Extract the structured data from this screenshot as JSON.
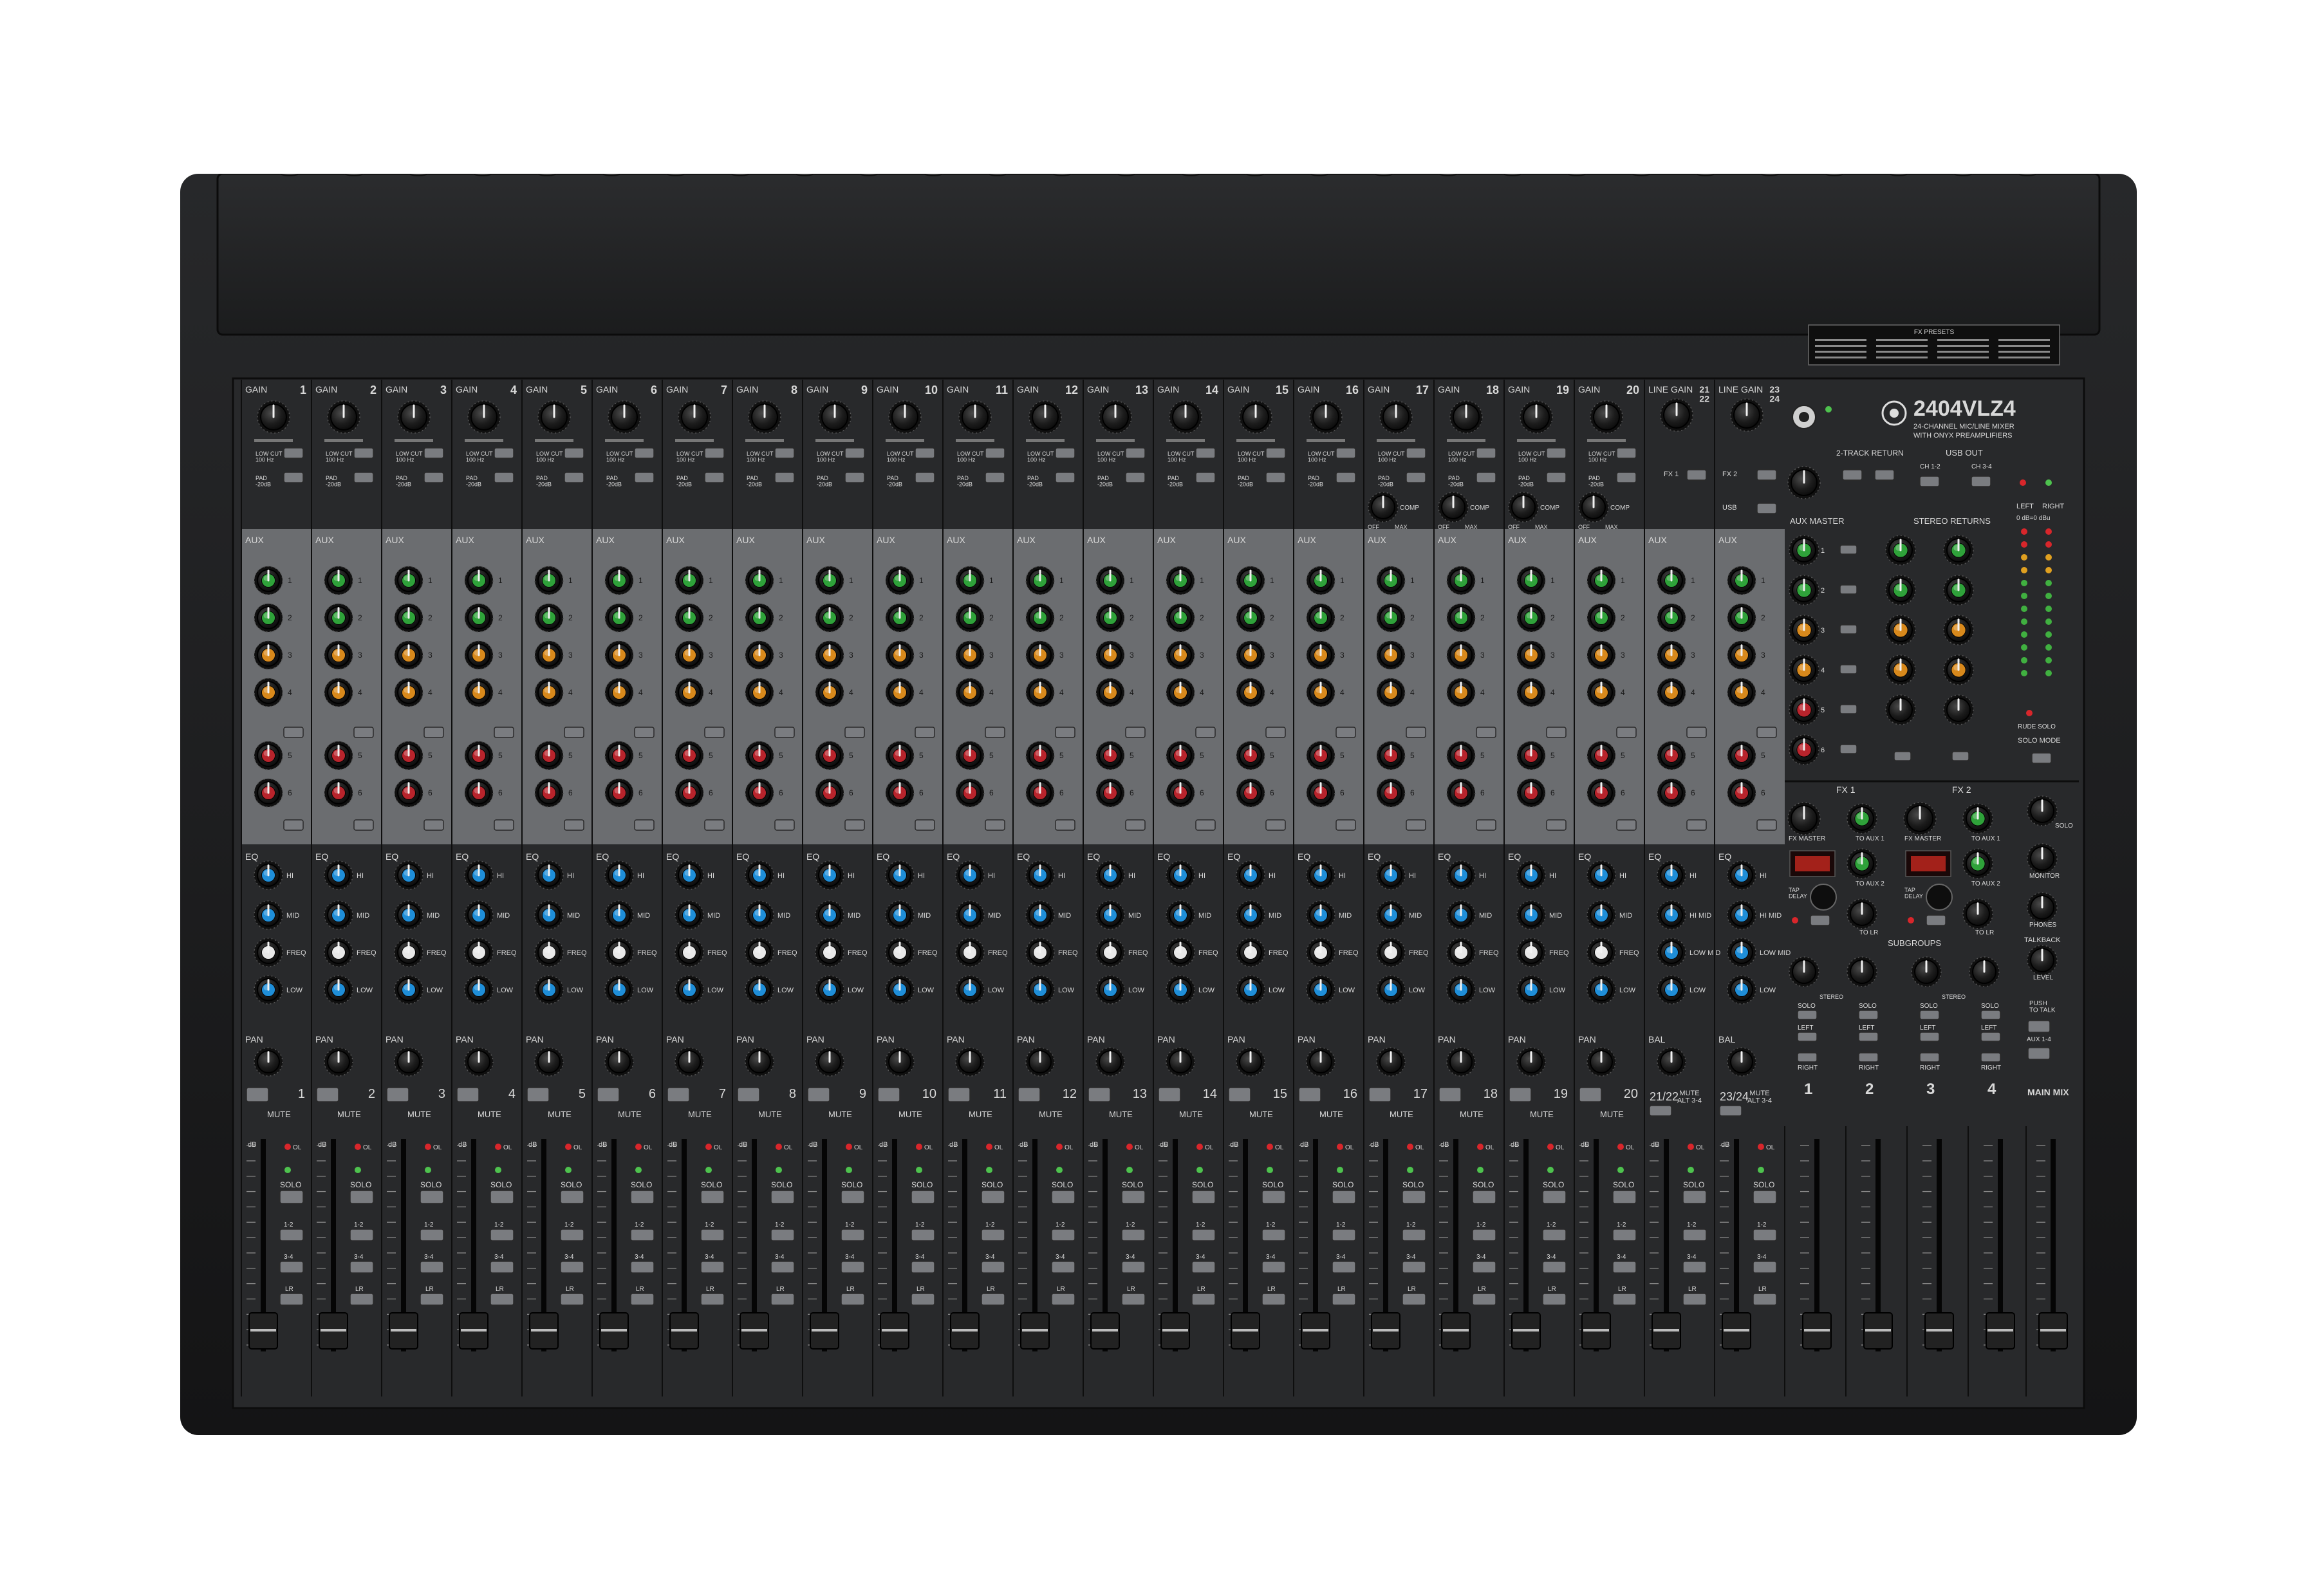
{
  "brand": {
    "model": "2404VLZ4",
    "subtitle_1": "24-CHANNEL MIC/LINE MIXER",
    "subtitle_2": "WITH ONYX PREAMPLIFIERS"
  },
  "presets_title": "FX PRESETS",
  "mono_channels": [
    "1",
    "2",
    "3",
    "4",
    "5",
    "6",
    "7",
    "8",
    "9",
    "10",
    "11",
    "12",
    "13",
    "14",
    "15",
    "16",
    "17",
    "18",
    "19",
    "20"
  ],
  "stereo_channels": [
    {
      "top_label": "21\n22",
      "bottom_label": "21/22",
      "mute_label": "MUTE\nALT 3-4"
    },
    {
      "top_label": "23\n24",
      "bottom_label": "23/24",
      "mute_label": "MUTE\nALT 3-4"
    }
  ],
  "labels": {
    "gain": "GAIN",
    "line_gain": "LINE GAIN",
    "low_cut": "LOW CUT\n100 Hz",
    "pad": "PAD\n-20dB",
    "comp": "COMP",
    "off": "OFF",
    "max": "MAX",
    "aux": "AUX",
    "eq": "EQ",
    "pan": "PAN",
    "bal": "BAL",
    "mute": "MUTE",
    "solo": "SOLO",
    "hi": "HI",
    "mid": "MID",
    "freq": "FREQ",
    "low": "LOW",
    "hi_mid": "HI MID",
    "low_mid": "LOW MID",
    "db": "dB",
    "ol": "OL",
    "bus12": "1-2",
    "bus34": "3-4",
    "lr": "LR"
  },
  "master": {
    "fx1": "FX 1",
    "fx2": "FX 2",
    "usb": "USB",
    "two_track_return": "2-TRACK RETURN",
    "usb_out": "USB OUT",
    "ch12": "CH 1-2",
    "ch34": "CH 3-4",
    "aux_master": "AUX MASTER",
    "stereo_returns": "STEREO RETURNS",
    "left": "LEFT",
    "right": "RIGHT",
    "rude_solo": "RUDE SOLO",
    "solo_mode": "SOLO MODE",
    "level_set": "0 dB=0 dBu",
    "fx_master": "FX MASTER",
    "to_aux_1": "TO AUX 1",
    "to_aux_2": "TO AUX 2",
    "to_lr": "TO LR",
    "tap_delay": "TAP\nDELAY",
    "subgroups": "SUBGROUPS",
    "stereo": "STEREO",
    "monitor": "MONITOR",
    "phones": "PHONES",
    "talkback": "TALKBACK",
    "level": "LEVEL",
    "push_to_talk": "PUSH\nTO TALK",
    "aux14": "AUX 1-4",
    "main_mix": "MAIN MIX",
    "subgroup_numbers": [
      "1",
      "2",
      "3",
      "4"
    ]
  },
  "colors": {
    "body": "#1c1c1d",
    "panel": "#28292b",
    "aux_panel": "#6b6d70",
    "knob": "#1b1b1b",
    "aux_green": "#2fa23a",
    "aux_orange": "#d8891c",
    "aux_red": "#b8242c",
    "eq_blue": "#1f8ed8",
    "eq_white": "#e8e8e8",
    "button": "#7a7c80",
    "fader_cap": "#222222"
  },
  "icons": [
    "mackie-logo-icon",
    "headphone-jack-icon",
    "power-led-icon"
  ]
}
